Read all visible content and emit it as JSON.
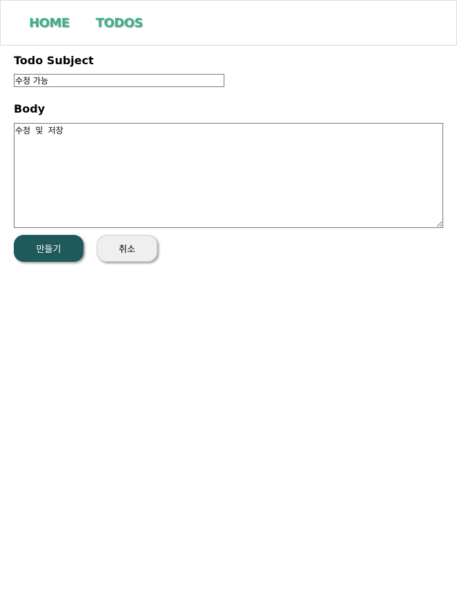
{
  "colors": {
    "accent": "#3cb08c",
    "primary": "#1e5a5c"
  },
  "nav": {
    "home_label": "HOME",
    "todos_label": "TODOS"
  },
  "form": {
    "subject_label": "Todo Subject",
    "subject_value": "수정 가능",
    "body_label": "Body",
    "body_value": "수정 및 저장"
  },
  "buttons": {
    "create_label": "만들기",
    "cancel_label": "취소"
  }
}
